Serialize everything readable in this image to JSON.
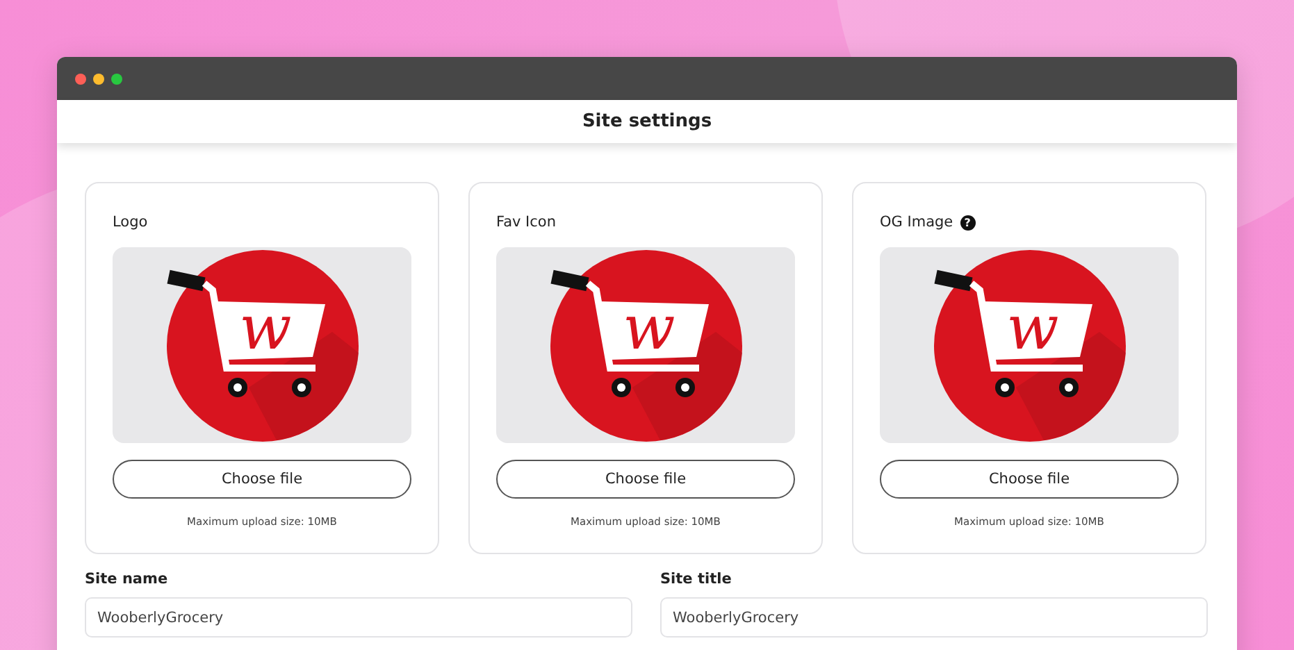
{
  "window": {
    "title": "Site settings"
  },
  "uploads": [
    {
      "label": "Logo",
      "mark": "w",
      "button": "Choose file",
      "note": "Maximum upload size: 10MB"
    },
    {
      "label": "Fav Icon",
      "mark": "w",
      "button": "Choose file",
      "note": "Maximum upload size: 10MB"
    },
    {
      "label": "OG Image",
      "help": "?",
      "mark": "w",
      "button": "Choose file",
      "note": "Maximum upload size: 10MB"
    }
  ],
  "fields": [
    {
      "label": "Site name",
      "value": "WooberlyGrocery"
    },
    {
      "label": "Site title",
      "value": "WooberlyGrocery"
    }
  ]
}
